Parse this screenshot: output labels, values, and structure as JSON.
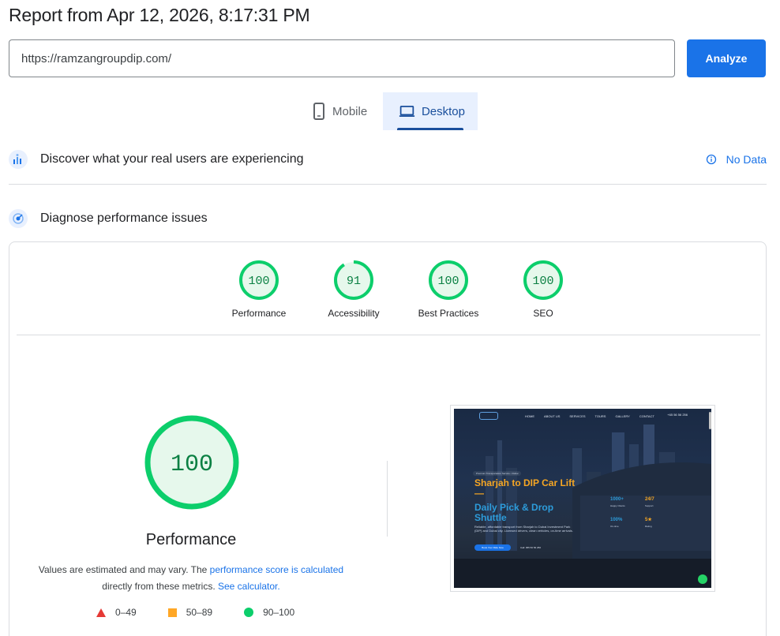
{
  "report": {
    "title": "Report from Apr 12, 2026, 8:17:31 PM"
  },
  "search": {
    "url_value": "https://ramzangroupdip.com/",
    "analyze_label": "Analyze"
  },
  "device_tabs": {
    "mobile_label": "Mobile",
    "desktop_label": "Desktop",
    "selected": "Desktop"
  },
  "field_data": {
    "title": "Discover what your real users are experiencing",
    "status_label": "No Data"
  },
  "lab": {
    "title": "Diagnose performance issues",
    "gauges": [
      {
        "label": "Performance",
        "score": "100",
        "fraction": 1.0
      },
      {
        "label": "Accessibility",
        "score": "91",
        "fraction": 0.91
      },
      {
        "label": "Best Practices",
        "score": "100",
        "fraction": 1.0
      },
      {
        "label": "SEO",
        "score": "100",
        "fraction": 1.0
      }
    ],
    "main_gauge": {
      "score": "100",
      "label": "Performance",
      "fraction": 1.0
    },
    "note": {
      "text1": "Values are estimated and may vary. The ",
      "link1": "performance score is calculated",
      "text2": "directly from these metrics. ",
      "link2": "See calculator."
    },
    "legend": [
      {
        "range": "0–49",
        "shape": "triangle",
        "color": "#e53935"
      },
      {
        "range": "50–89",
        "shape": "square",
        "color": "#ffa726"
      },
      {
        "range": "90–100",
        "shape": "circle",
        "color": "#0cce6b"
      }
    ]
  },
  "screenshot": {
    "nav_items": [
      "HOME",
      "ABOUT US",
      "SERVICES",
      "TOURS",
      "GALLERY",
      "CONTACT"
    ],
    "phone": "+65 56 56 256",
    "badge": "Premium Transportation Service • Dubai",
    "heading1": "Sharjah to DIP Car Lift —",
    "heading2": "Daily Pick & Drop Shuttle",
    "description": "Reliable, affordable transport from Sharjah to Dubai Investment Park (DIP) and Dubai city. Licensed drivers, clean vehicles, on-time arrivals.",
    "cta": "Book Your Ride Now",
    "call": "Call: 055 56 56 256",
    "stats": [
      {
        "value": "1000+",
        "label": "Happy Clients"
      },
      {
        "value": "24/7",
        "label": "Support"
      },
      {
        "value": "100%",
        "label": "On-time"
      },
      {
        "value": "5★",
        "label": "Rating"
      }
    ]
  },
  "colors": {
    "accent": "#1a73e8",
    "pass": "#0cce6b",
    "pass_text": "#0b8043"
  }
}
